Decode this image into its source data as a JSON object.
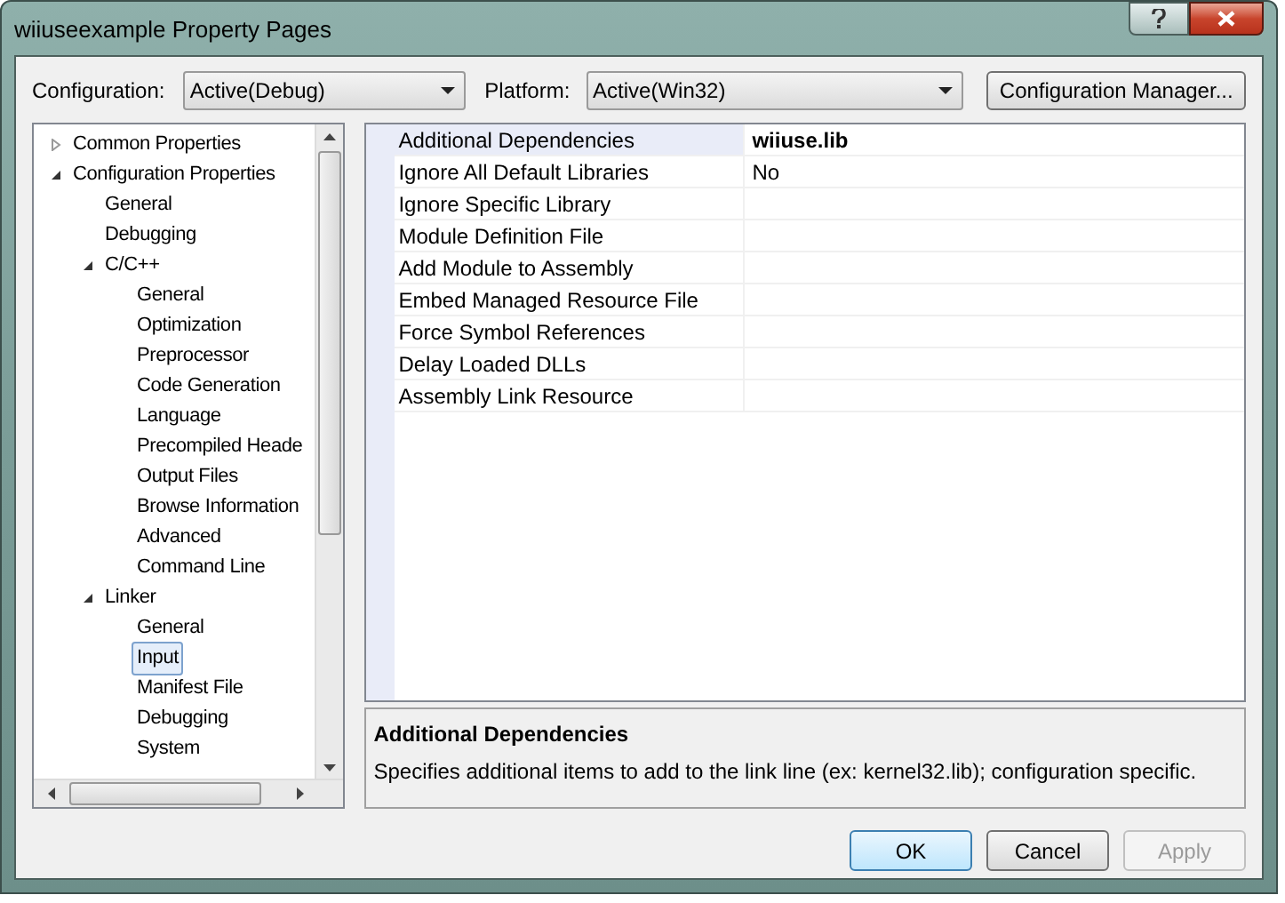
{
  "window": {
    "title": "wiiuseexample Property Pages"
  },
  "configuration": {
    "label": "Configuration:",
    "value": "Active(Debug)"
  },
  "platform": {
    "label": "Platform:",
    "value": "Active(Win32)"
  },
  "configuration_manager_button": "Configuration Manager...",
  "tree": [
    {
      "label": "Common Properties",
      "expanded": false,
      "selected": false
    },
    {
      "label": "Configuration Properties",
      "expanded": true,
      "selected": false,
      "children": [
        {
          "label": "General",
          "selected": false
        },
        {
          "label": "Debugging",
          "selected": false
        },
        {
          "label": "C/C++",
          "expanded": true,
          "selected": false,
          "children": [
            {
              "label": "General",
              "selected": false
            },
            {
              "label": "Optimization",
              "selected": false
            },
            {
              "label": "Preprocessor",
              "selected": false
            },
            {
              "label": "Code Generation",
              "selected": false
            },
            {
              "label": "Language",
              "selected": false
            },
            {
              "label": "Precompiled Heade",
              "selected": false
            },
            {
              "label": "Output Files",
              "selected": false
            },
            {
              "label": "Browse Information",
              "selected": false
            },
            {
              "label": "Advanced",
              "selected": false
            },
            {
              "label": "Command Line",
              "selected": false
            }
          ]
        },
        {
          "label": "Linker",
          "expanded": true,
          "selected": false,
          "children": [
            {
              "label": "General",
              "selected": false
            },
            {
              "label": "Input",
              "selected": true
            },
            {
              "label": "Manifest File",
              "selected": false
            },
            {
              "label": "Debugging",
              "selected": false
            },
            {
              "label": "System",
              "selected": false
            }
          ]
        }
      ]
    }
  ],
  "properties": [
    {
      "name": "Additional Dependencies",
      "value": "wiiuse.lib",
      "selected": true,
      "modified": true
    },
    {
      "name": "Ignore All Default Libraries",
      "value": "No",
      "selected": false,
      "modified": false
    },
    {
      "name": "Ignore Specific Library",
      "selected": false
    },
    {
      "name": "Module Definition File",
      "selected": false
    },
    {
      "name": "Add Module to Assembly",
      "selected": false
    },
    {
      "name": "Embed Managed Resource File",
      "selected": false
    },
    {
      "name": "Force Symbol References",
      "selected": false
    },
    {
      "name": "Delay Loaded DLLs",
      "selected": false
    },
    {
      "name": "Assembly Link Resource",
      "selected": false
    }
  ],
  "description": {
    "title": "Additional Dependencies",
    "text": "Specifies additional items to add to the link line (ex: kernel32.lib); configuration specific."
  },
  "buttons": [
    {
      "label": "OK",
      "default": true,
      "disabled": false
    },
    {
      "label": "Cancel",
      "default": false,
      "disabled": false
    },
    {
      "label": "Apply",
      "default": false,
      "disabled": true
    }
  ]
}
